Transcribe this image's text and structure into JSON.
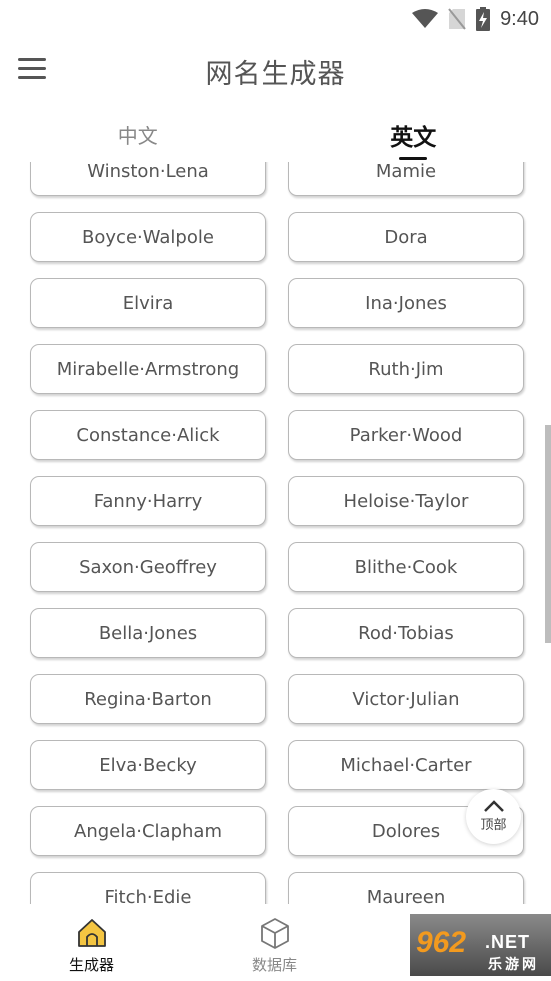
{
  "status_bar": {
    "time": "9:40",
    "icons": [
      "wifi-icon",
      "no-sim-icon",
      "battery-charging-icon"
    ]
  },
  "app_bar": {
    "menu_icon": "hamburger-menu-icon",
    "title": "网名生成器"
  },
  "tabs": [
    {
      "label": "中文",
      "active": false
    },
    {
      "label": "英文",
      "active": true
    }
  ],
  "names": [
    "Winston·Lena",
    "Mamie",
    "Boyce·Walpole",
    "Dora",
    "Elvira",
    "Ina·Jones",
    "Mirabelle·Armstrong",
    "Ruth·Jim",
    "Constance·Alick",
    "Parker·Wood",
    "Fanny·Harry",
    "Heloise·Taylor",
    "Saxon·Geoffrey",
    "Blithe·Cook",
    "Bella·Jones",
    "Rod·Tobias",
    "Regina·Barton",
    "Victor·Julian",
    "Elva·Becky",
    "Michael·Carter",
    "Angela·Clapham",
    "Dolores",
    "Fitch·Edie",
    "Maureen"
  ],
  "back_to_top": {
    "icon": "chevron-up-icon",
    "label": "顶部"
  },
  "bottom_nav": [
    {
      "label": "生成器",
      "icon": "home-icon",
      "active": true
    },
    {
      "label": "数据库",
      "icon": "cube-icon",
      "active": false
    }
  ],
  "watermark": {
    "number": "962",
    "domain": ".NET",
    "text": "乐游网"
  },
  "colors": {
    "accent_icon": "#f4c542",
    "card_border": "#b8b8b8",
    "text": "#555555",
    "active_text": "#111111"
  }
}
